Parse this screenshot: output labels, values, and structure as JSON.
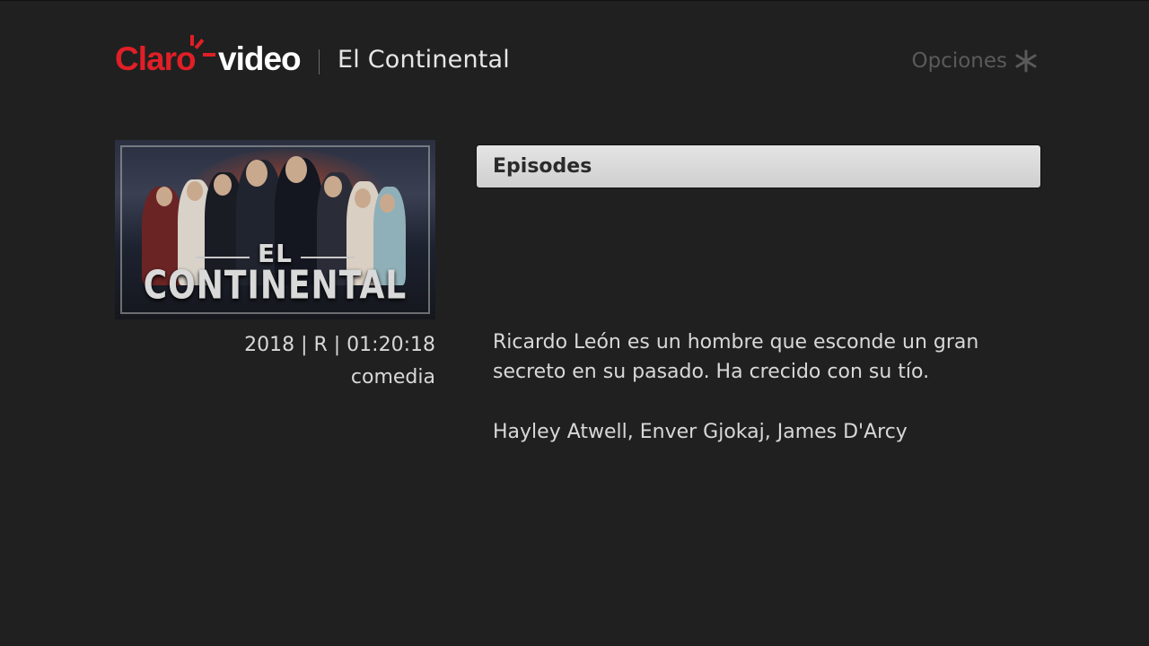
{
  "brand": {
    "logo_left": "Claro",
    "logo_right": "video",
    "accent_color": "#e01f26"
  },
  "header": {
    "title": "El Continental",
    "options_label": "Opciones",
    "options_icon": "asterisk-icon"
  },
  "poster": {
    "title_small": "EL",
    "title_big": "CONTINENTAL"
  },
  "meta": {
    "info_line": "2018 | R | 01:20:18",
    "genre": "comedia"
  },
  "actions": {
    "episodes_label": "Episodes"
  },
  "details": {
    "description": "Ricardo León es un hombre que esconde un gran secreto en su pasado. Ha crecido con su tío.",
    "cast": "Hayley Atwell, Enver Gjokaj, James D'Arcy"
  }
}
